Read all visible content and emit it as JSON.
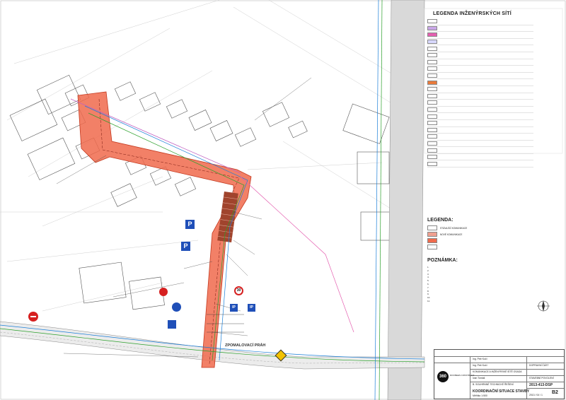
{
  "legend": {
    "title": "LEGENDA INŽENÝRSKÝCH SÍTÍ",
    "items": [
      {
        "label": "",
        "color": "#ffffff"
      },
      {
        "label": "",
        "color": "#c9a7e8"
      },
      {
        "label": "",
        "color": "#e45fb0"
      },
      {
        "label": "",
        "color": "#d8d8ff"
      },
      {
        "label": "",
        "color": "#ffffff"
      },
      {
        "label": "",
        "color": "#ffffff"
      },
      {
        "label": "",
        "color": "#ffffff"
      },
      {
        "label": "",
        "color": "#ffffff"
      },
      {
        "label": "",
        "color": "#ffffff"
      },
      {
        "label": "",
        "color": "#e97a3b"
      },
      {
        "label": "",
        "color": "#ffffff"
      },
      {
        "label": "",
        "color": "#ffffff"
      },
      {
        "label": "",
        "color": "#ffffff"
      },
      {
        "label": "",
        "color": "#ffffff"
      },
      {
        "label": "",
        "color": "#ffffff"
      },
      {
        "label": "",
        "color": "#ffffff"
      },
      {
        "label": "",
        "color": "#ffffff"
      },
      {
        "label": "",
        "color": "#ffffff"
      },
      {
        "label": "",
        "color": "#ffffff"
      },
      {
        "label": "",
        "color": "#ffffff"
      },
      {
        "label": "",
        "color": "#ffffff"
      },
      {
        "label": "",
        "color": "#ffffff"
      }
    ]
  },
  "legend2": {
    "title": "LEGENDA:",
    "items": [
      {
        "label": "STÁVAJÍCÍ KOMUNIKACE",
        "color": "#ffffff"
      },
      {
        "label": "NOVÉ KOMUNIKACE",
        "color": "#f0a090"
      },
      {
        "label": "",
        "color": "#f06a4c"
      },
      {
        "label": "",
        "color": "#ffffff"
      }
    ]
  },
  "notes": {
    "title": "POZNÁMKA:",
    "lines": [
      "1.",
      "2.",
      "3.",
      "4.",
      "5.",
      "6.",
      "7.",
      "8.",
      "9.",
      "10.",
      "11."
    ]
  },
  "titleblock": {
    "company": "ROOBEES CONSTRUCT",
    "logo_text": "360",
    "rows": [
      "Ing. Petr Kočí",
      "Ing. Petr Kočí",
      "KOMUNIKACE A INŽENÝRSKÉ SÍTĚ OSADA",
      "Ivan Tomáš",
      "B. SOUHRNNÉ TECHNICKÉ ŘEŠENÍ"
    ],
    "drawing_title": "KOORDINAČNÍ SITUACE STAVBY",
    "scale": "Měřítko 1:500",
    "code": "2013-413-DSP",
    "sheet": "B2",
    "date": "2013 / 04 / 1",
    "stage": "STAVEBNÍ POVOLENÍ",
    "part": "DOPRAVNÍ ČÁST"
  },
  "map": {
    "road_label": "ZPOMALOVACÍ PRÁH",
    "signs": [
      "P",
      "P",
      "30",
      "IP",
      "IP"
    ]
  }
}
